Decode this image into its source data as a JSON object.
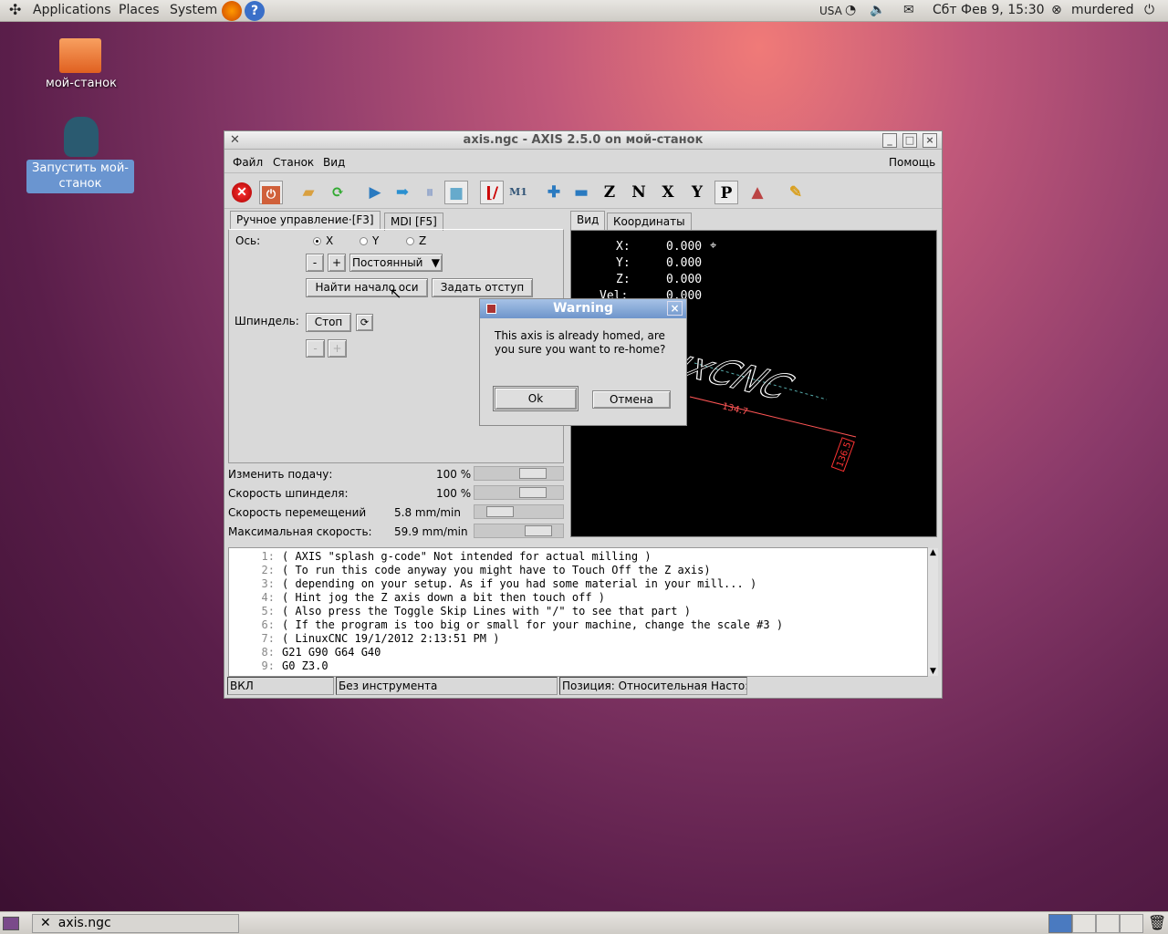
{
  "top_panel": {
    "menus": [
      "Applications",
      "Places",
      "System"
    ],
    "keyboard": "USA",
    "datetime": "Сбт Фев  9, 15:30",
    "user": "murdered"
  },
  "desktop": {
    "icons": [
      {
        "label": "мой-станок"
      },
      {
        "label": "Запустить мой-станок"
      }
    ]
  },
  "window": {
    "title": "axis.ngc - AXIS 2.5.0 on мой-станок",
    "menu": [
      "Файл",
      "Станок",
      "Вид"
    ],
    "help": "Помощь",
    "left_tabs": [
      "Ручное управление·[F3]",
      "MDI [F5]"
    ],
    "manual": {
      "axis_label": "Ось:",
      "axes": [
        "X",
        "Y",
        "Z"
      ],
      "selected_axis": "X",
      "minus": "-",
      "plus": "+",
      "jog_mode": "Постоянный",
      "home_button": "Найти начало оси",
      "touch_off_button": "Задать отступ",
      "spindle_label": "Шпиндель:",
      "spindle_stop": "Стоп",
      "spindle_minus": "-",
      "spindle_plus": "+"
    },
    "overrides": [
      {
        "label": "Изменить подачу:",
        "value": "100 %",
        "level": 0.75
      },
      {
        "label": "Скорость шпинделя:",
        "value": "100 %",
        "level": 0.75
      },
      {
        "label": "Скорость перемещений",
        "value": "5.8 mm/min",
        "level": 0.2
      },
      {
        "label": "Максимальная скорость:",
        "value": "59.9 mm/min",
        "level": 0.85
      }
    ],
    "right_tabs": [
      "Вид",
      "Координаты"
    ],
    "dro": [
      {
        "axis": "X:",
        "value": "0.000"
      },
      {
        "axis": "Y:",
        "value": "0.000"
      },
      {
        "axis": "Z:",
        "value": "0.000"
      },
      {
        "axis": "Vel:",
        "value": "0.000"
      }
    ],
    "preview": {
      "text": "LinuxCNC",
      "dim_x": "134.7",
      "dim_y": "136.5"
    },
    "code": [
      "( AXIS \"splash g-code\" Not intended for actual milling )",
      "( To run this code anyway you might have to Touch Off the Z axis)",
      "( depending on your setup. As if you had some material in your mill... )",
      "( Hint jog the Z axis down a bit then touch off )",
      "( Also press the Toggle Skip Lines with \"/\" to see that part )",
      "( If the program is too big or small for your machine, change the scale #3 )",
      "( LinuxCNC 19/1/2012 2:13:51 PM )",
      "G21 G90 G64 G40",
      "G0 Z3.0"
    ],
    "status": [
      "ВКЛ",
      "Без инструмента",
      "Позиция: Относительная Насто:"
    ]
  },
  "dialog": {
    "title": "Warning",
    "message": "This axis is already homed, are you sure you want to re-home?",
    "ok": "Ok",
    "cancel": "Отмена"
  },
  "taskbar": {
    "task": "axis.ngc"
  }
}
